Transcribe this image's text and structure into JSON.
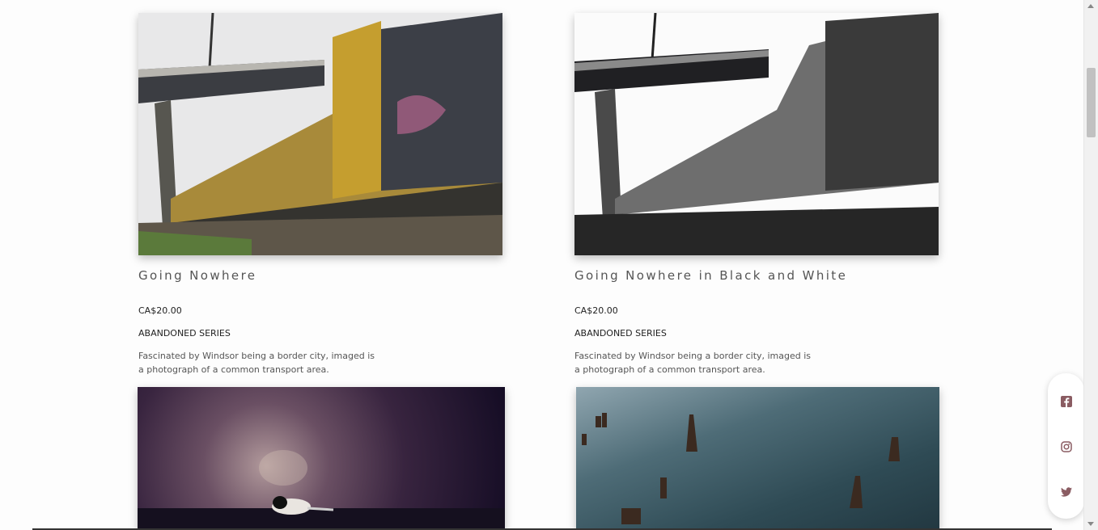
{
  "products": [
    {
      "title": "Going Nowhere",
      "price": "CA$20.00",
      "series": "ABANDONED SERIES",
      "description": "Fascinated by Windsor being a border city, imaged is a photograph of a common transport area."
    },
    {
      "title": "Going Nowhere in Black and White",
      "price": "CA$20.00",
      "series": "ABANDONED SERIES",
      "description": "Fascinated by Windsor being a border city, imaged is a photograph of a common transport area."
    }
  ],
  "social": {
    "icons": [
      "facebook-icon",
      "instagram-icon",
      "twitter-icon"
    ],
    "color": "#8a5c62"
  }
}
